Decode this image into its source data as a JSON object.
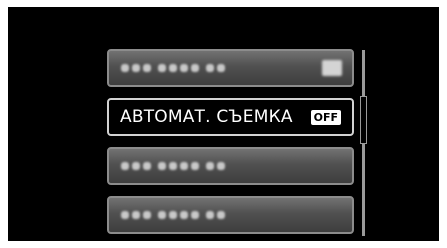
{
  "menu": {
    "items": [
      {
        "label": "",
        "value": "",
        "selected": false
      },
      {
        "label": "АВТОМАТ. СЪЕМКА",
        "value": "OFF",
        "selected": true
      },
      {
        "label": "",
        "value": "",
        "selected": false
      },
      {
        "label": "",
        "value": "",
        "selected": false
      }
    ]
  },
  "scrollbar": {
    "visible": true
  }
}
